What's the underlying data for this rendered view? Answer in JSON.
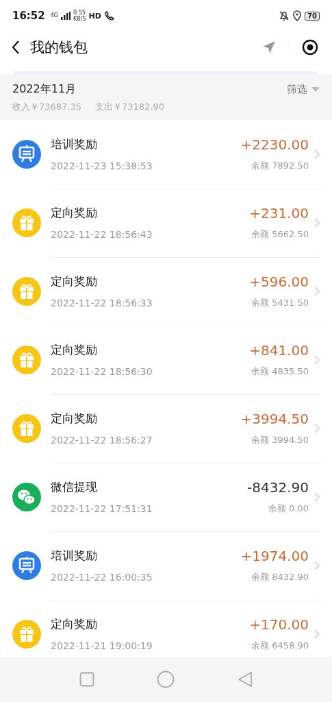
{
  "status_bar": {
    "time": "16:52",
    "network": "4G",
    "speed": "0.55",
    "speed_unit": "KB/S",
    "hd": "HD",
    "battery": "70"
  },
  "nav": {
    "title": "我的钱包"
  },
  "summary": {
    "month": "2022年11月",
    "filter": "筛选",
    "income": "收入￥73687.35",
    "expense": "支出￥73182.90"
  },
  "transactions": [
    {
      "kind": "training",
      "title": "培训奖励",
      "time": "2022-11-23 15:38:53",
      "amount": "+2230.00",
      "color": "#c66a3a",
      "balance": "余额 7892.50"
    },
    {
      "kind": "gift",
      "title": "定向奖励",
      "time": "2022-11-22 18:56:43",
      "amount": "+231.00",
      "color": "#c66a3a",
      "balance": "余额 5662.50"
    },
    {
      "kind": "gift",
      "title": "定向奖励",
      "time": "2022-11-22 18:56:33",
      "amount": "+596.00",
      "color": "#c66a3a",
      "balance": "余额 5431.50"
    },
    {
      "kind": "gift",
      "title": "定向奖励",
      "time": "2022-11-22 18:56:30",
      "amount": "+841.00",
      "color": "#c66a3a",
      "balance": "余额 4835.50"
    },
    {
      "kind": "gift",
      "title": "定向奖励",
      "time": "2022-11-22 18:56:27",
      "amount": "+3994.50",
      "color": "#c66a3a",
      "balance": "余额 3994.50"
    },
    {
      "kind": "wechat",
      "title": "微信提现",
      "time": "2022-11-22 17:51:31",
      "amount": "-8432.90",
      "color": "#333333",
      "balance": "余额 0.00"
    },
    {
      "kind": "training",
      "title": "培训奖励",
      "time": "2022-11-22 16:00:35",
      "amount": "+1974.00",
      "color": "#c66a3a",
      "balance": "余额 8432.90"
    },
    {
      "kind": "gift",
      "title": "定向奖励",
      "time": "2022-11-21 19:00:19",
      "amount": "+170.00",
      "color": "#c66a3a",
      "balance": "余额 6458.90"
    }
  ]
}
